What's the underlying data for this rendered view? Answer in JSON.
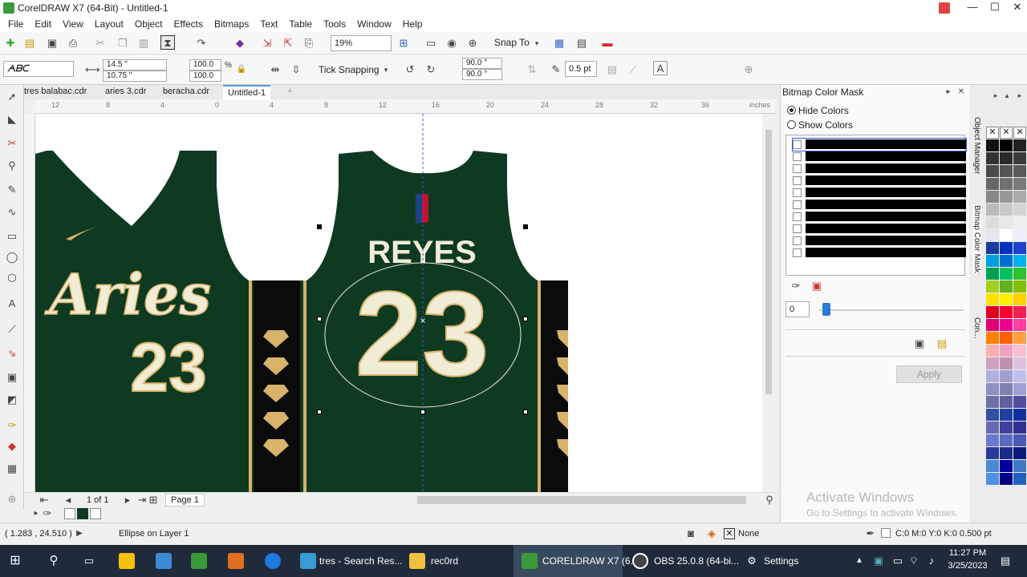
{
  "window": {
    "title": "CorelDRAW X7 (64-Bit) - Untitled-1",
    "minimize": "—",
    "maximize": "☐",
    "close": "✕"
  },
  "menu": [
    "File",
    "Edit",
    "View",
    "Layout",
    "Object",
    "Effects",
    "Bitmaps",
    "Text",
    "Table",
    "Tools",
    "Window",
    "Help"
  ],
  "toolbar": {
    "zoom": "19%",
    "snap_to": "Snap To"
  },
  "propertybar": {
    "size_w": "14.5 \"",
    "size_h": "10.75 \"",
    "scale_x": "100.0",
    "scale_y": "100.0",
    "pct": "%",
    "tick_snapping": "Tick Snapping",
    "angle1": "90.0 °",
    "angle2": "90.0 °",
    "outline": "0.5 pt"
  },
  "doc_tabs": [
    "tres balabac.cdr",
    "aries 3.cdr",
    "beracha.cdr",
    "Untitled-1"
  ],
  "ruler": {
    "labels": [
      "12",
      "8",
      "4",
      "0",
      "4",
      "8",
      "12",
      "16",
      "20",
      "24",
      "28",
      "32",
      "36"
    ],
    "unit": "inches"
  },
  "canvas": {
    "jersey_left": {
      "script": "Aries",
      "number": "23"
    },
    "jersey_right": {
      "name": "REYES",
      "number": "23"
    }
  },
  "page_nav": {
    "count": "1 of 1",
    "page_tab": "Page 1"
  },
  "status": {
    "coords": "( 1.283 , 24.510 )",
    "selection": "Ellipse on Layer 1",
    "fill": "None",
    "outline": "C:0 M:0 Y:0 K:0  0.500 pt"
  },
  "docker": {
    "title": "Bitmap Color Mask",
    "hide_colors": "Hide Colors",
    "show_colors": "Show Colors",
    "tolerance": "0",
    "apply": "Apply",
    "mask_rows": 10
  },
  "vertical_tabs": [
    "Object Manager",
    "Bitmap Color Mask",
    "Con..."
  ],
  "watermark": {
    "line1": "Activate Windows",
    "line2": "Go to Settings to activate Windows."
  },
  "taskbar": {
    "items": [
      "tres - Search Res...",
      "rec0rd",
      "CORELDRAW X7 (6...",
      "OBS 25.0.8 (64-bi...",
      "Settings"
    ],
    "time": "11:27 PM",
    "date": "3/25/2023"
  },
  "colors": {
    "jersey": "#0e3a22",
    "cream": "#f1ecd6",
    "gold": "#d9b36a",
    "accent": "#2a5ad5"
  }
}
